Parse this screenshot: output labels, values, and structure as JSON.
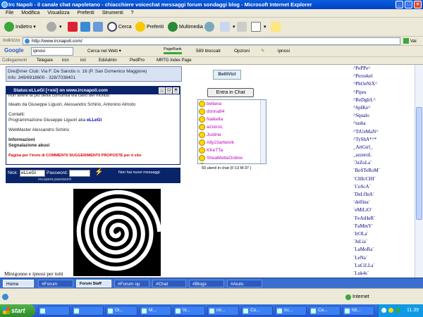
{
  "window": {
    "title": "Irc Napoli - il canale chat napoletano - chiacchiere voicechat messaggi forum sondaggi blog - Microsoft Internet Explorer"
  },
  "menu": [
    "File",
    "Modifica",
    "Visualizza",
    "Preferiti",
    "Strumenti",
    "?"
  ],
  "toolbar": {
    "back": "Indietro",
    "search": "Cerca",
    "favorites": "Preferiti",
    "multimedia": "Multimedia"
  },
  "address": {
    "label": "Indirizzo",
    "url": "http://www.ircnapoli.com/",
    "go": "Vai"
  },
  "google": {
    "logo": "Google",
    "query": "ipnosi",
    "search_web": "Cerca nel Web",
    "pagerank": "PageRank",
    "blocked": "589 bloccati",
    "options": "Opzioni",
    "highlight": "ipnosi"
  },
  "links": {
    "label": "Collegamenti",
    "items": [
      "Telegare",
      "ircn",
      "ircl",
      "EdiAdmin",
      "PwdPro",
      "MRTG Index Page"
    ]
  },
  "page": {
    "info_line1": "Dre@mer Club: Via F. De Sanctis n. 16 (P. San Domenico Maggiore)",
    "info_line2": "Info: 349/6918600 - 328/7038401",
    "status_title": "Status:eLLeGi [+xni] on www.ircnapoli.com",
    "status_lines": {
      "cut": "non avere la più bella comunità via cavo del mondo",
      "ideato": "Ideato da Giuseppe Liguori, Alessandro Schirio, Antonino Almoto",
      "contatti": "Contatti:",
      "prog_prefix": "Programmazione Giuseppe Liguori aka ",
      "prog_nick": "eLLeGi",
      "webmaster": "WebMaster Alessandro Schirio",
      "informazioni": "Informazioni",
      "segnalazione": "Segnalazione abusi",
      "red_notice": "Pagina per l'invio di COMMENTI/ SUGGERIMENTI/ PROPOSTE per il sito"
    },
    "login": {
      "nick_label": "Nick:",
      "nick_value": "eLLeGi",
      "pwd_label": "Password:",
      "no_messages": "Non hai nuovi messaggi",
      "recover": "recupera password"
    },
    "caption": "Minigonne e ipnosi per tutti",
    "weblink": "BelliVicI",
    "enter_chat": "Entra in Chat",
    "user_count": "50 utenti in chat (F:13 M:37 )"
  },
  "chat_users": [
    "bellana",
    "donna84",
    "Naikella",
    "azzeroL",
    "Justine",
    "Ally23artwork",
    "KKeTTa",
    "SheaMetteOrdine",
    "verusia75"
  ],
  "nick_column": [
    "^PePPe^",
    "^Perzekel",
    "^PhOeNiX^",
    "^Pipes",
    "^ReDgIrL^",
    "^SpIKe^",
    "^Squalo",
    "^tasha",
    "^TrUeMaN^",
    "^TyShA*^*",
    "_ArtGirl_",
    "_azzeroL",
    "`3zZoLa`",
    "`BoSTeRoM`",
    "`CHIcCHI`",
    "`CoScA`",
    "`DeLfInA`",
    "`delfina`",
    "`eMiLiO`",
    "`FeAtHeR`",
    "`FaMmY`",
    "`IrOLa`",
    "`JuLia`",
    "`LaMoRa`",
    "`LeNa`",
    "`LuCiLLa`",
    "`Luk4s`"
  ],
  "tabs": [
    "Home",
    "#Forum",
    "Forum Staff",
    "#Forum op",
    "#Chat",
    "#Blogs",
    "#Aiuto"
  ],
  "statusbar": {
    "zone": "Internet"
  },
  "taskbar": {
    "start": "start",
    "tasks": [
      "",
      "",
      "Gi...",
      "M...",
      "\\\\t...",
      "ml...",
      "Co...",
      "Irc...",
      "Ce...",
      "htt..."
    ],
    "clock": "11.39"
  },
  "colors": {
    "titlebar": "#0a5fe0",
    "status_title": "#0a246a",
    "nick_color": "#000080",
    "user_color": "#c000c0"
  }
}
